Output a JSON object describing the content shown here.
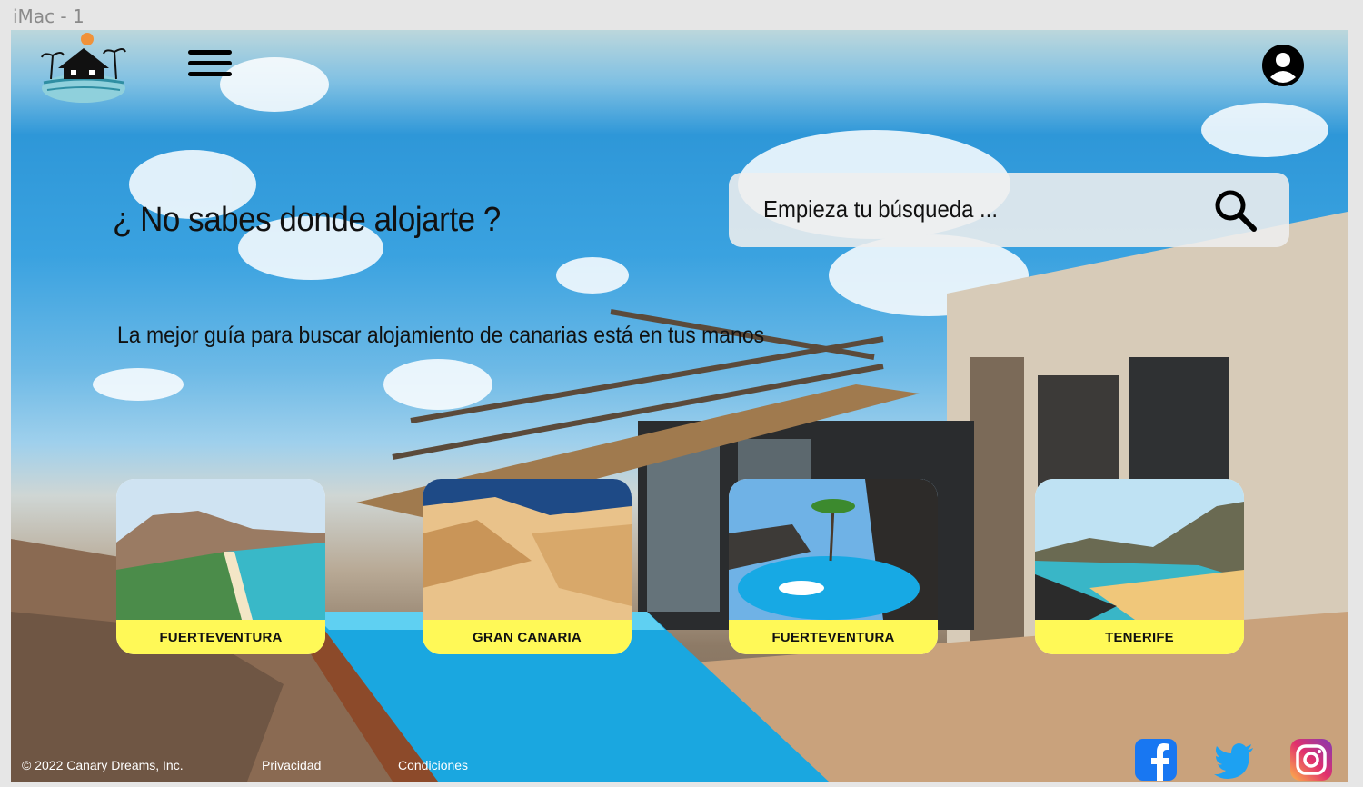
{
  "window": {
    "frame_label": "iMac - 1"
  },
  "header": {
    "logo_icon": "beach-house-logo",
    "menu_icon": "hamburger-menu-icon",
    "profile_icon": "user-account-icon"
  },
  "hero": {
    "title": "¿ No sabes donde alojarte ?",
    "subtitle": "La mejor guía para buscar alojamiento de canarias está en tus manos"
  },
  "search": {
    "placeholder": "Empieza tu búsqueda ...",
    "value": "",
    "icon": "search-icon"
  },
  "destinations": [
    {
      "label": "FUERTEVENTURA"
    },
    {
      "label": "GRAN CANARIA"
    },
    {
      "label": "FUERTEVENTURA"
    },
    {
      "label": "TENERIFE"
    }
  ],
  "footer": {
    "copyright": "© 2022 Canary Dreams, Inc.",
    "privacy": "Privacidad",
    "conditions": "Condiciones",
    "social": [
      "facebook-icon",
      "twitter-icon",
      "instagram-icon"
    ]
  },
  "colors": {
    "card_label_bg": "#fff957",
    "sky": "#3aa2e0",
    "facebook": "#1877f2",
    "twitter": "#1da1f2"
  }
}
